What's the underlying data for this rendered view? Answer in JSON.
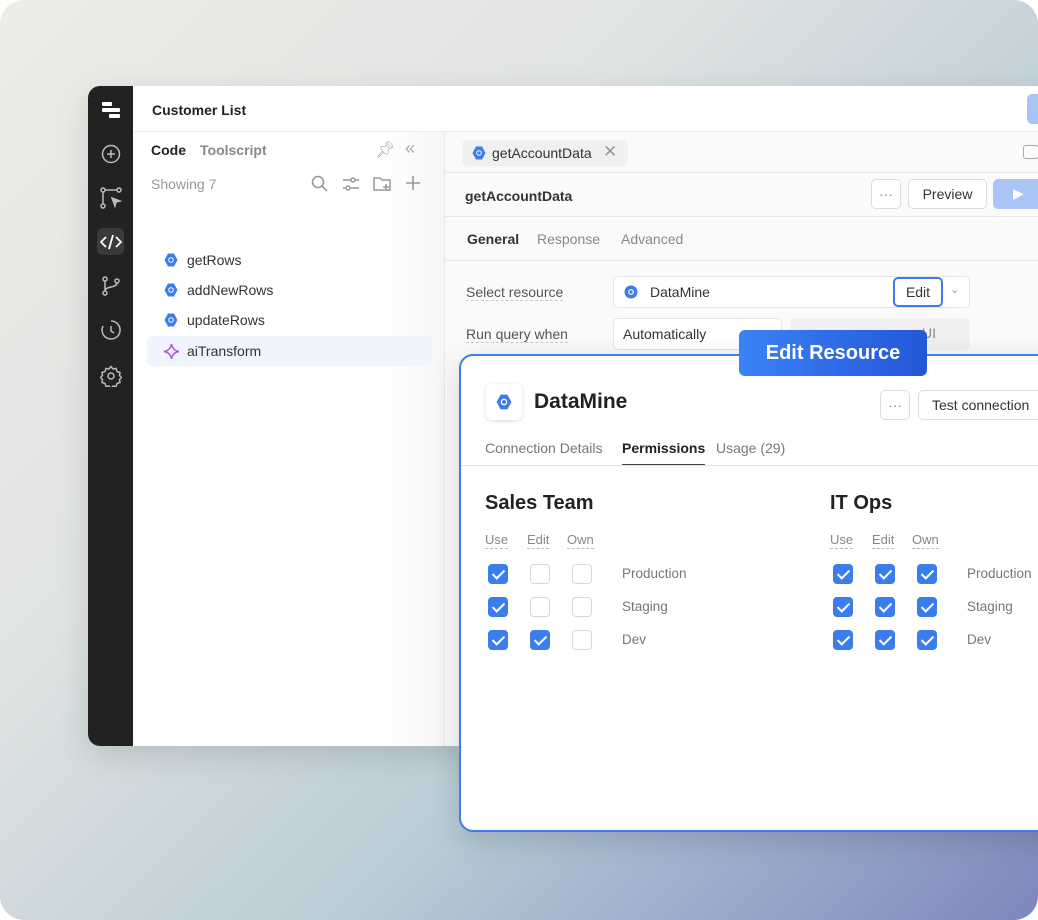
{
  "app": {
    "title": "Customer List"
  },
  "rail": {
    "icons": [
      "logo-icon",
      "plus-circle-icon",
      "flow-icon",
      "code-icon",
      "branch-icon",
      "history-icon",
      "gear-icon"
    ],
    "active": "code-icon"
  },
  "left": {
    "tabs": [
      "Code",
      "Toolscript"
    ],
    "showing": "Showing 7",
    "items": [
      {
        "label": "getRows",
        "icon": "query-icon"
      },
      {
        "label": "addNewRows",
        "icon": "query-icon"
      },
      {
        "label": "updateRows",
        "icon": "query-icon"
      },
      {
        "label": "aiTransform",
        "icon": "sparkle-icon",
        "selected": true
      }
    ]
  },
  "editor": {
    "tab": "getAccountData",
    "query_name": "getAccountData",
    "more": "···",
    "preview": "Preview",
    "subtabs": [
      "General",
      "Response",
      "Advanced"
    ],
    "resource_label": "Select resource",
    "resource_value": "DataMine",
    "edit": "Edit",
    "run_label": "Run query when",
    "run_value": "Automatically",
    "partial": "UI"
  },
  "badge": "Edit Resource",
  "modal": {
    "title": "DataMine",
    "more": "···",
    "test": "Test connection",
    "tabs": [
      "Connection Details",
      "Permissions",
      "Usage (29)"
    ],
    "active_tab": "Permissions",
    "columns": [
      "Use",
      "Edit",
      "Own"
    ],
    "groups": [
      {
        "name": "Sales Team",
        "rows": [
          {
            "env": "Production",
            "checks": [
              true,
              false,
              false
            ]
          },
          {
            "env": "Staging",
            "checks": [
              true,
              false,
              false
            ]
          },
          {
            "env": "Dev",
            "checks": [
              true,
              true,
              false
            ]
          }
        ]
      },
      {
        "name": "IT Ops",
        "rows": [
          {
            "env": "Production",
            "checks": [
              true,
              true,
              true
            ]
          },
          {
            "env": "Staging",
            "checks": [
              true,
              true,
              true
            ]
          },
          {
            "env": "Dev",
            "checks": [
              true,
              true,
              true
            ]
          }
        ]
      }
    ]
  },
  "colors": {
    "accent": "#3b7ded",
    "rail": "#222222",
    "ai": "#b455d8"
  }
}
